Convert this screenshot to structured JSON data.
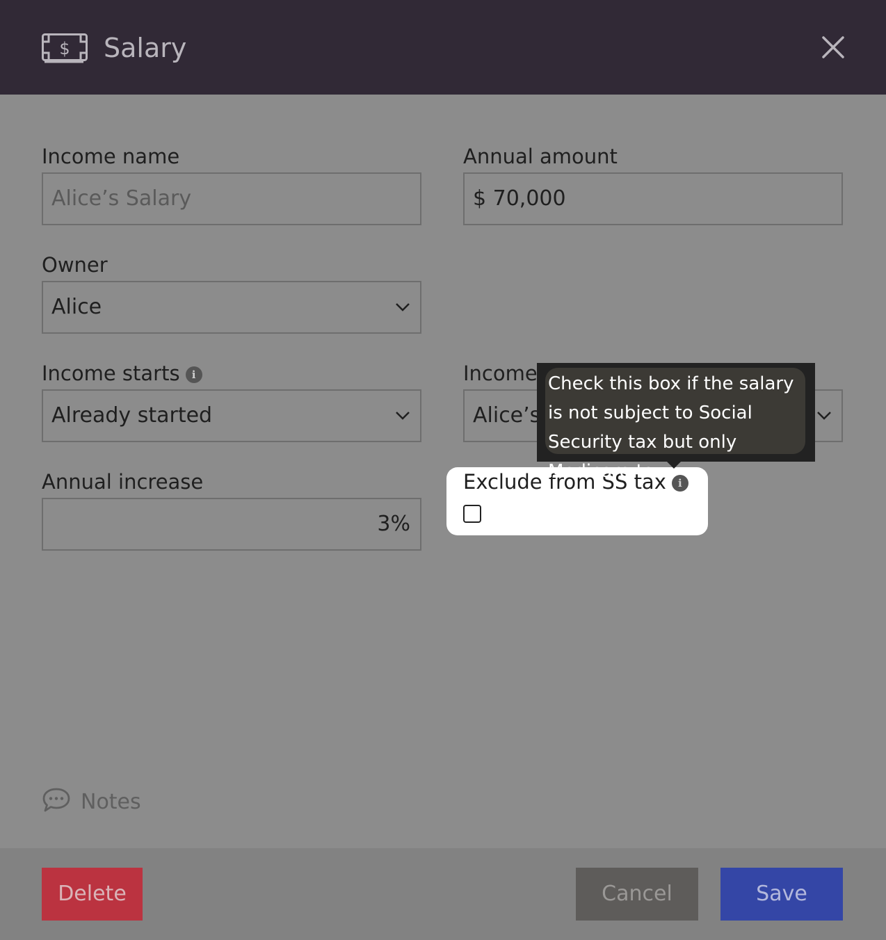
{
  "header": {
    "title": "Salary",
    "icon": "money-bill-icon"
  },
  "form": {
    "income_name": {
      "label": "Income name",
      "placeholder": "Alice’s Salary"
    },
    "annual_amount": {
      "label": "Annual amount",
      "value": "$ 70,000"
    },
    "owner": {
      "label": "Owner",
      "value": "Alice"
    },
    "income_starts": {
      "label": "Income starts",
      "value": "Already started"
    },
    "income_ends": {
      "label": "Income",
      "value": "Alice’s"
    },
    "annual_increase": {
      "label": "Annual increase",
      "value": "3%"
    },
    "exclude_ss": {
      "label": "Exclude from SS tax",
      "checked": false
    }
  },
  "tooltip": {
    "text": "Check this box if the salary is not subject to Social Security tax but only Medicare tax"
  },
  "notes": {
    "label": "Notes"
  },
  "footer": {
    "delete_label": "Delete",
    "cancel_label": "Cancel",
    "save_label": "Save"
  },
  "colors": {
    "header_bg": "#312936",
    "delete": "#bb3340",
    "save": "#3446a6",
    "cancel": "#5e5c5a"
  }
}
